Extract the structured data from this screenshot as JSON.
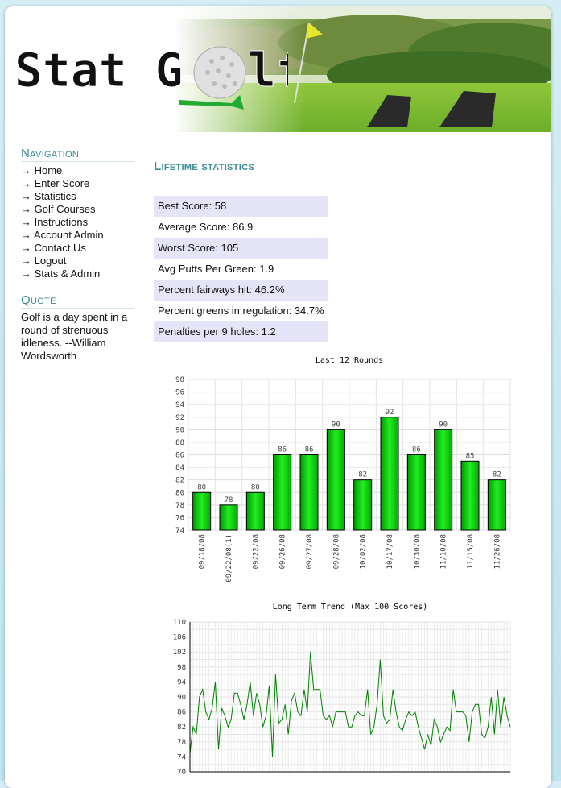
{
  "header": {
    "logo_text_left": "Stat G",
    "logo_text_right": "lf"
  },
  "sidebar": {
    "nav_heading": "Navigation",
    "nav_items": [
      {
        "label": "→ Home"
      },
      {
        "label": "→ Enter Score"
      },
      {
        "label": "→ Statistics"
      },
      {
        "label": "→ Golf Courses"
      },
      {
        "label": "→ Instructions"
      },
      {
        "label": "→ Account Admin"
      },
      {
        "label": "→ Contact Us"
      },
      {
        "label": "→ Logout"
      },
      {
        "label": "→ Stats & Admin"
      }
    ],
    "quote_heading": "Quote",
    "quote_text": "Golf is a day spent in a round of strenuous idleness. --William Wordsworth"
  },
  "main": {
    "title": "Lifetime statistics",
    "stats": [
      {
        "label": "Best Score: 58"
      },
      {
        "label": "Average Score: 86.9"
      },
      {
        "label": "Worst Score: 105"
      },
      {
        "label": "Avg Putts Per Green: 1.9"
      },
      {
        "label": "Percent fairways hit: 46.2%"
      },
      {
        "label": "Percent greens in regulation: 34.7%"
      },
      {
        "label": "Penalties per 9 holes: 1.2"
      }
    ]
  },
  "colors": {
    "accent": "#3b8c95",
    "stat_alt_bg": "#e5e5f7",
    "bar_green": "#00cc00",
    "line_green": "#008000"
  },
  "chart_data": [
    {
      "type": "bar",
      "title": "Last 12 Rounds",
      "categories": [
        "09/18/08",
        "09/22/08(1)",
        "09/22/08",
        "09/26/08",
        "09/27/08",
        "09/28/08",
        "10/02/08",
        "10/17/08",
        "10/30/08",
        "11/10/08",
        "11/15/08",
        "11/26/08"
      ],
      "values": [
        80,
        78,
        80,
        86,
        86,
        90,
        82,
        92,
        86,
        90,
        85,
        82
      ],
      "ylim": [
        74,
        98
      ],
      "yticks": [
        74,
        76,
        78,
        80,
        82,
        84,
        86,
        88,
        90,
        92,
        94,
        96,
        98
      ],
      "grid": true,
      "data_labels": true
    },
    {
      "type": "line",
      "title": "Long Term Trend (Max 100 Scores)",
      "values": [
        75,
        82,
        80,
        90,
        92,
        86,
        84,
        87,
        94,
        76,
        87,
        85,
        82,
        84,
        91,
        91,
        88,
        84,
        88,
        94,
        85,
        91,
        88,
        82,
        85,
        93,
        74,
        96,
        83,
        84,
        88,
        80,
        89,
        91,
        86,
        85,
        92,
        86,
        102,
        92,
        92,
        92,
        85,
        84,
        85,
        82,
        86,
        86,
        86,
        86,
        82,
        82,
        85,
        86,
        85,
        85,
        92,
        80,
        82,
        88,
        100,
        85,
        83,
        84,
        92,
        86,
        82,
        81,
        84,
        86,
        85,
        86,
        82,
        79,
        76,
        80,
        77,
        84,
        82,
        78,
        80,
        82,
        81,
        92,
        86,
        86,
        86,
        85,
        78,
        86,
        88,
        88,
        80,
        79,
        82,
        90,
        80,
        92,
        82,
        90,
        85,
        82
      ],
      "ylim": [
        70,
        110
      ],
      "yticks": [
        70,
        74,
        78,
        82,
        86,
        90,
        94,
        98,
        102,
        106,
        110
      ],
      "grid": true
    }
  ]
}
